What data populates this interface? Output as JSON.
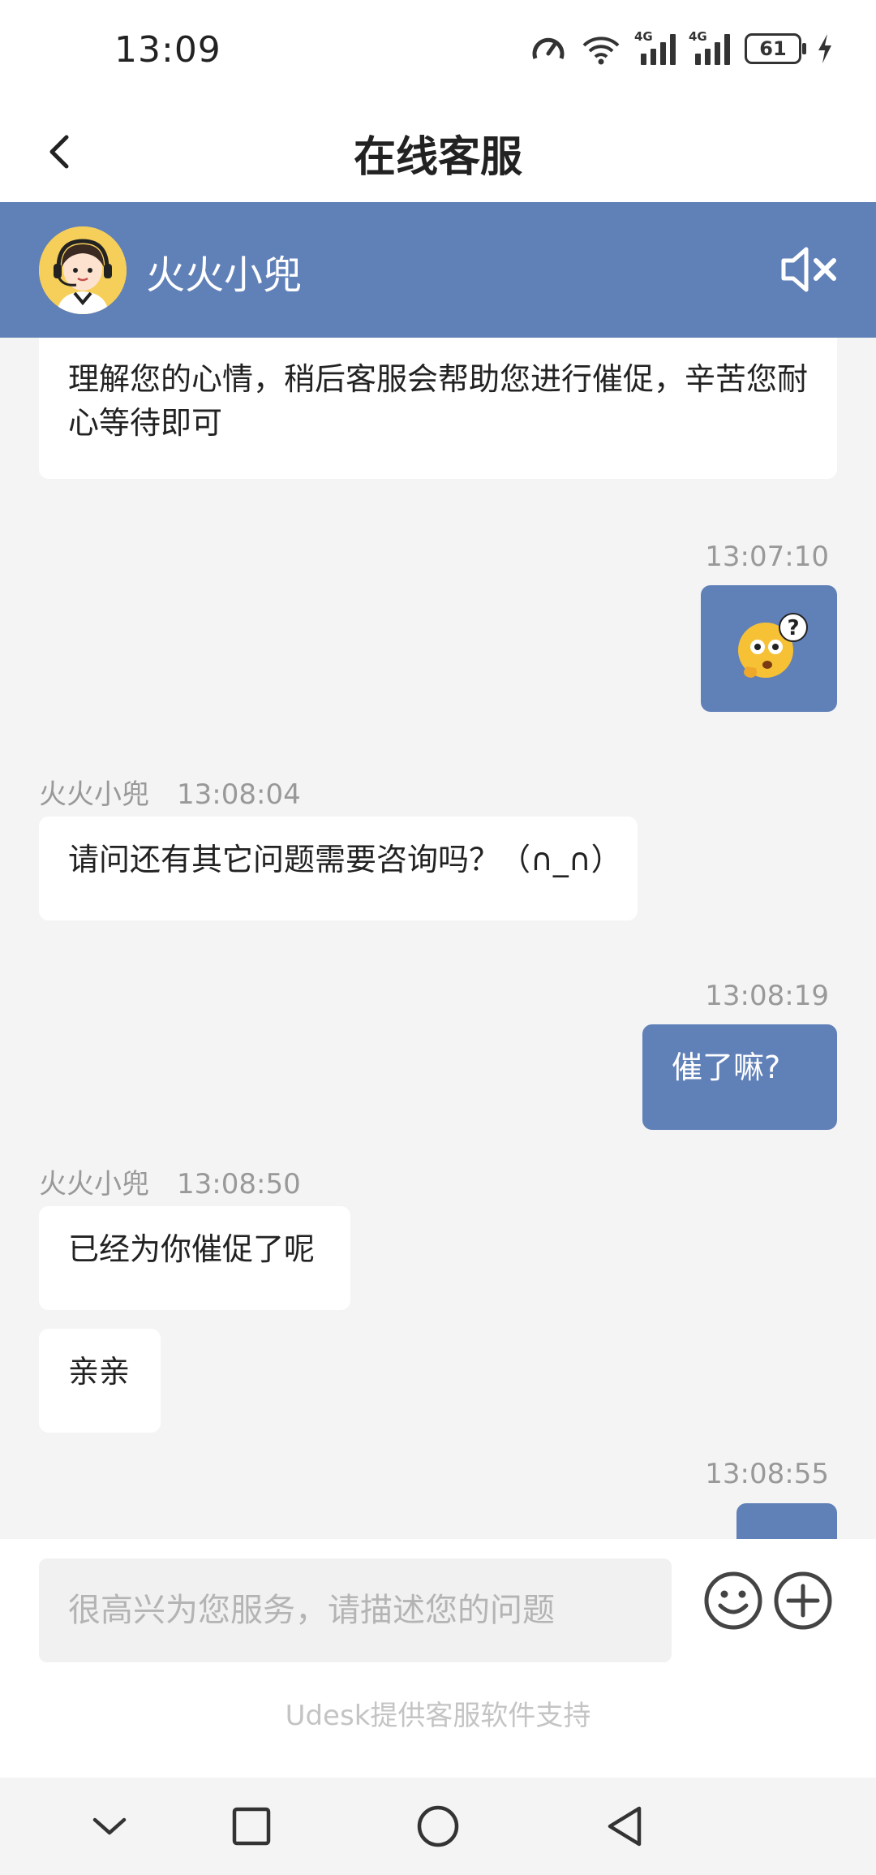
{
  "status_bar": {
    "time": "13:09",
    "network_label_1": "4G",
    "network_label_2": "4G",
    "battery": "61",
    "icons": [
      "speed-meter-icon",
      "wifi-icon",
      "signal-icon",
      "signal-icon",
      "battery-icon",
      "charging-icon"
    ]
  },
  "header": {
    "title": "在线客服",
    "back_icon": "chevron-left-icon"
  },
  "agent": {
    "name": "火火小兜",
    "mute_icon": "speaker-muted-icon"
  },
  "messages": [
    {
      "side": "left",
      "text": "理解您的心情，稍后客服会帮助您进行催促，辛苦您耐心等待即可"
    },
    {
      "side": "right",
      "time": "13:07:10",
      "type": "emoji",
      "emoji": "thinking-question-emoji"
    },
    {
      "side": "left",
      "sender": "火火小兜",
      "time": "13:08:04",
      "text": "请问还有其它问题需要咨询吗？（∩_∩）"
    },
    {
      "side": "right",
      "time": "13:08:19",
      "text": "催了嘛?"
    },
    {
      "side": "left",
      "sender": "火火小兜",
      "time": "13:08:50",
      "text": "已经为你催促了呢"
    },
    {
      "side": "left",
      "text": "亲亲"
    },
    {
      "side": "right",
      "time": "13:08:55",
      "type": "partial"
    }
  ],
  "input": {
    "placeholder": "很高兴为您服务，请描述您的问题",
    "emoji_icon": "smiley-icon",
    "plus_icon": "plus-circle-icon"
  },
  "footer": {
    "powered_by": "Udesk提供客服软件支持"
  },
  "nav": {
    "icons": [
      "chevron-down-icon",
      "square-icon",
      "circle-icon",
      "triangle-back-icon"
    ]
  },
  "colors": {
    "brand": "#6080b8",
    "background": "#f4f4f4"
  }
}
